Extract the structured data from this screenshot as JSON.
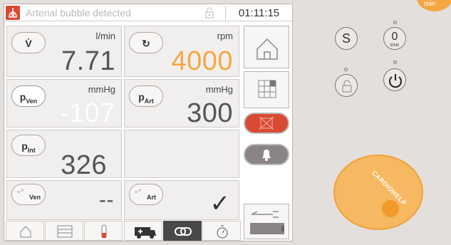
{
  "status": {
    "alarm_text": "Arterial bubble detected",
    "time": "01:11:15"
  },
  "cells": {
    "flow": {
      "unit": "l/min",
      "value": "7.71",
      "symbol": "V̇"
    },
    "speed": {
      "unit": "rpm",
      "value": "4000",
      "symbol": "↻"
    },
    "pven": {
      "unit": "mmHg",
      "value": "-107",
      "symbol": "p",
      "sub": "Ven"
    },
    "part": {
      "unit": "mmHg",
      "value": "300",
      "symbol": "p",
      "sub": "Art"
    },
    "pint": {
      "value": "326",
      "symbol": "p",
      "sub": "Int"
    },
    "bubble_ven": {
      "value": "--",
      "sub": "Ven"
    },
    "bubble_art": {
      "sub": "Art",
      "check": "✓"
    }
  },
  "hardware": {
    "s_label": "S",
    "zero_label": "0",
    "zero_sub": "l/min",
    "brand": "CARDIOHELP",
    "corner_label": "min"
  },
  "colors": {
    "accent_orange": "#f4a742",
    "alarm_red": "#d94a33"
  }
}
